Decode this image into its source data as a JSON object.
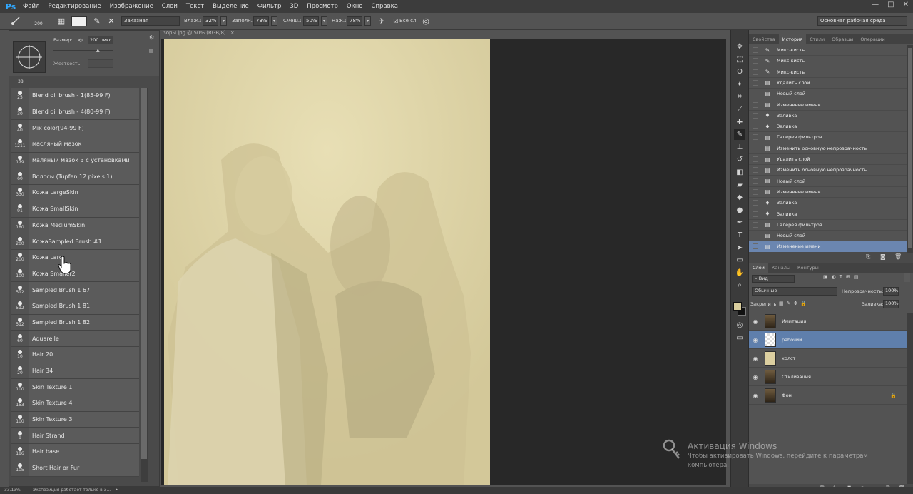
{
  "app": {
    "logo": "Ps"
  },
  "menu": [
    "Файл",
    "Редактирование",
    "Изображение",
    "Слои",
    "Текст",
    "Выделение",
    "Фильтр",
    "3D",
    "Просмотр",
    "Окно",
    "Справка"
  ],
  "window_controls": [
    "—",
    "□",
    "✕"
  ],
  "options": {
    "size_value": "200",
    "mode": "Заказная",
    "wetness_label": "Влаж.:",
    "wetness_value": "32%",
    "load_label": "Заполн.:",
    "load_value": "73%",
    "mix_label": "Смеш.:",
    "mix_value": "50%",
    "flow_label": "Наж.:",
    "flow_value": "78%",
    "all_layers": "Все сл.",
    "workspace": "Основная рабочая среда"
  },
  "brush_panel": {
    "size_label": "Размер:",
    "size_value": "200 пикс.",
    "hardness_label": "Жесткость:",
    "top_number": "38",
    "presets": [
      {
        "num": "25",
        "name": "Blend oil brush - 1(85-99 F)"
      },
      {
        "num": "30",
        "name": "Blend oil brush - 4(80-99 F)"
      },
      {
        "num": "40",
        "name": "Mix color(94-99 F)"
      },
      {
        "num": "1211",
        "name": "масляный мазок"
      },
      {
        "num": "179",
        "name": "маляный мазок 3 с установками"
      },
      {
        "num": "60",
        "name": "Волосы (Tupfen 12 pixels 1)"
      },
      {
        "num": "330",
        "name": "Кожа LargeSkin"
      },
      {
        "num": "91",
        "name": "Кожа SmallSkin"
      },
      {
        "num": "180",
        "name": "Кожа MediumSkin"
      },
      {
        "num": "200",
        "name": "КожаSampled Brush #1"
      },
      {
        "num": "200",
        "name": "Кожа Larc"
      },
      {
        "num": "100",
        "name": "Кожа Smaller2"
      },
      {
        "num": "512",
        "name": "Sampled Brush 1 67"
      },
      {
        "num": "512",
        "name": "Sampled Brush 1 81"
      },
      {
        "num": "512",
        "name": "Sampled Brush 1 82"
      },
      {
        "num": "60",
        "name": "Aquarelle"
      },
      {
        "num": "10",
        "name": "Hair 20"
      },
      {
        "num": "20",
        "name": "Hair 34"
      },
      {
        "num": "100",
        "name": "Skin Texture 1"
      },
      {
        "num": "153",
        "name": "Skin Texture 4"
      },
      {
        "num": "100",
        "name": "Skin Texture 3"
      },
      {
        "num": "9",
        "name": "Hair Strand"
      },
      {
        "num": "186",
        "name": "Hair base"
      },
      {
        "num": "105",
        "name": "Short Hair or Fur"
      }
    ]
  },
  "document": {
    "tab_title": "зоры.jpg @ 50% (RGB/8)"
  },
  "history_tabs": [
    "Свойства",
    "История",
    "Стили",
    "Образцы",
    "Операции"
  ],
  "history": [
    {
      "icon": "brush",
      "label": "Микс-кисть"
    },
    {
      "icon": "brush",
      "label": "Микс-кисть"
    },
    {
      "icon": "brush",
      "label": "Микс-кисть"
    },
    {
      "icon": "doc",
      "label": "Удалить слой"
    },
    {
      "icon": "doc",
      "label": "Новый слой"
    },
    {
      "icon": "doc",
      "label": "Изменение имени"
    },
    {
      "icon": "fill",
      "label": "Заливка"
    },
    {
      "icon": "fill",
      "label": "Заливка"
    },
    {
      "icon": "doc",
      "label": "Галерея фильтров"
    },
    {
      "icon": "doc",
      "label": "Изменить основную непрозрачность"
    },
    {
      "icon": "doc",
      "label": "Удалить слой"
    },
    {
      "icon": "doc",
      "label": "Изменить основную непрозрачность"
    },
    {
      "icon": "doc",
      "label": "Новый слой"
    },
    {
      "icon": "doc",
      "label": "Изменение имени"
    },
    {
      "icon": "fill",
      "label": "Заливка"
    },
    {
      "icon": "fill",
      "label": "Заливка"
    },
    {
      "icon": "doc",
      "label": "Галерея фильтров"
    },
    {
      "icon": "doc",
      "label": "Новый слой"
    },
    {
      "icon": "doc",
      "label": "Изменение имени"
    }
  ],
  "layers_tabs": [
    "Слои",
    "Каналы",
    "Контуры"
  ],
  "layers_panel": {
    "kind_filter": "Вид",
    "blend_mode": "Обычные",
    "opacity_label": "Непрозрачность:",
    "opacity_value": "100%",
    "lock_label": "Закрепить:",
    "fill_label": "Заливка:",
    "fill_value": "100%"
  },
  "layers": [
    {
      "name": "Имитация",
      "thumb": "photo"
    },
    {
      "name": "рабочий",
      "thumb": "transparent"
    },
    {
      "name": "холст",
      "thumb": "canvas"
    },
    {
      "name": "Стилизация",
      "thumb": "photo"
    },
    {
      "name": "Фон",
      "thumb": "photo",
      "locked": true
    }
  ],
  "status": {
    "zoom": "33.13%",
    "message": "Экспозиция работает только в 3..."
  },
  "watermark": {
    "title": "Активация Windows",
    "line1": "Чтобы активировать Windows, перейдите к параметрам",
    "line2": "компьютера."
  },
  "colors": {
    "selected": "#6b86b0",
    "canvas": "#d8cea0",
    "foreground": "#d9cd9d",
    "background": "#111111"
  }
}
